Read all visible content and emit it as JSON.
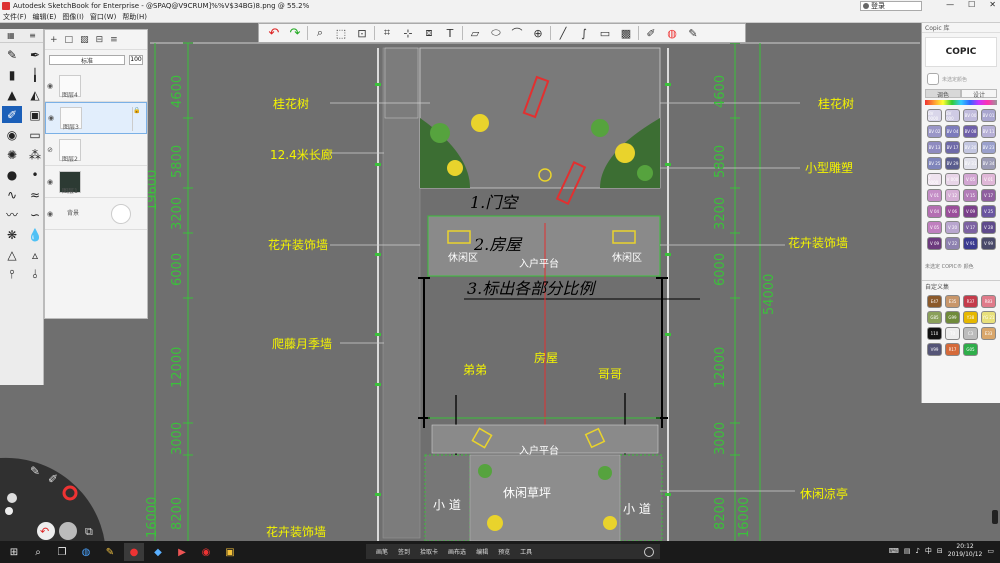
{
  "window": {
    "title": "Autodesk SketchBook for Enterprise - @SPAQ@V9CRUM]%%V$34BG)8.png @ 55.2%",
    "minimize": "—",
    "maximize": "☐",
    "close": "✕",
    "login_label": "登录"
  },
  "menu": [
    "文件(F)",
    "编辑(E)",
    "图像(I)",
    "窗口(W)",
    "帮助(H)"
  ],
  "toolbar": {
    "tools": [
      "undo-icon",
      "redo-icon",
      "zoom-icon",
      "select-icon",
      "lasso-icon",
      "crop-icon",
      "transform-icon",
      "symmetry-icon",
      "text-icon",
      "ruler-icon",
      "ellipse-icon",
      "french-curve-icon",
      "perspective-icon",
      "line-icon",
      "curve-icon",
      "rect-icon",
      "fill-icon",
      "copic-icon",
      "color-wheel-icon",
      "brush-icon"
    ]
  },
  "layers": {
    "blend_mode": "标准",
    "opacity": "100",
    "items": [
      {
        "name": "图层4"
      },
      {
        "name": "图层3"
      },
      {
        "name": "图层2"
      },
      {
        "name": "图层1"
      },
      {
        "name": "背景"
      }
    ]
  },
  "plan": {
    "left_labels": [
      "桂花树",
      "12.4米长廊",
      "花卉装饰墙",
      "爬藤月季墙",
      "花卉装饰墙"
    ],
    "right_labels": [
      "桂花树",
      "小型雕塑",
      "花卉装饰墙",
      "休闲凉亭"
    ],
    "center_labels": {
      "entry_top": "入户平台",
      "rest_left": "休闲区",
      "rest_right": "休闲区",
      "house": "房屋",
      "younger": "弟弟",
      "elder": "哥哥",
      "entry_bottom": "入户平台",
      "lawn": "休闲草坪",
      "path_left": "小 道",
      "path_right": "小 道"
    },
    "left_dims": [
      "4600",
      "5800",
      "3200",
      "6000",
      "12000",
      "3000",
      "8200"
    ],
    "left_outer_dims": [
      "19600",
      "16000"
    ],
    "right_dims": [
      "4600",
      "5800",
      "3200",
      "6000",
      "12000",
      "3000",
      "8200"
    ],
    "right_outer_dims": [
      "54000",
      "16000"
    ],
    "handwriting": [
      "1.门空",
      "2.房屋",
      "3.标出各部分比例"
    ]
  },
  "copic": {
    "title": "Copic 库",
    "logo": "COPIC",
    "no_color": "未选定颜色",
    "tabs": [
      "调色",
      "设计"
    ],
    "library_colors": [
      {
        "code": "BV 0000",
        "color": "#d9d6ea"
      },
      {
        "code": "BV 000",
        "color": "#cfcbe4"
      },
      {
        "code": "BV 00",
        "color": "#c0bbdc"
      },
      {
        "code": "BV 01",
        "color": "#a9a6cf"
      },
      {
        "code": "BV 02",
        "color": "#9a96c8"
      },
      {
        "code": "BV 04",
        "color": "#7d7cbc"
      },
      {
        "code": "BV 08",
        "color": "#6e5fa9"
      },
      {
        "code": "BV 11",
        "color": "#b6b0d6"
      },
      {
        "code": "BV 13",
        "color": "#8f8bc0"
      },
      {
        "code": "BV 17",
        "color": "#6f6aa8"
      },
      {
        "code": "BV 20",
        "color": "#c3c6e0"
      },
      {
        "code": "BV 23",
        "color": "#9aa0cc"
      },
      {
        "code": "BV 25",
        "color": "#7f85bb"
      },
      {
        "code": "BV 29",
        "color": "#5a5d8e"
      },
      {
        "code": "BV 31",
        "color": "#e2e2ec"
      },
      {
        "code": "BV 34",
        "color": "#9c9cb6"
      },
      {
        "code": "V 0000",
        "color": "#efe3ef"
      },
      {
        "code": "V 000",
        "color": "#e8d5e8"
      },
      {
        "code": "V 05",
        "color": "#d2a6d2"
      },
      {
        "code": "V 01",
        "color": "#e0b8d8"
      },
      {
        "code": "V 01",
        "color": "#c58ec7"
      },
      {
        "code": "V 12",
        "color": "#d6b0d6"
      },
      {
        "code": "V 15",
        "color": "#b27cb8"
      },
      {
        "code": "V 17",
        "color": "#8f5f9f"
      },
      {
        "code": "V 04",
        "color": "#b46fb2"
      },
      {
        "code": "V 06",
        "color": "#9a4e9a"
      },
      {
        "code": "V 09",
        "color": "#7a3f8a"
      },
      {
        "code": "V 25",
        "color": "#6a55a0"
      },
      {
        "code": "V 05",
        "color": "#c07fbf"
      },
      {
        "code": "V 20",
        "color": "#b9a6cf"
      },
      {
        "code": "V 17",
        "color": "#7d62a2"
      },
      {
        "code": "V 28",
        "color": "#5f4a8c"
      },
      {
        "code": "V 09",
        "color": "#6d3b7e"
      },
      {
        "code": "V 22",
        "color": "#8e82b0"
      },
      {
        "code": "V 91",
        "color": "#3b3b8f"
      },
      {
        "code": "V 99",
        "color": "#4a4a6a"
      }
    ],
    "library_footer": "未选定 COPIC® 颜色",
    "custom_title": "自定义集",
    "custom_colors": [
      {
        "code": "E47",
        "color": "#8b5a2b"
      },
      {
        "code": "E35",
        "color": "#c8966a"
      },
      {
        "code": "R37",
        "color": "#c43b4a"
      },
      {
        "code": "R83",
        "color": "#e07b8a"
      },
      {
        "code": "G85",
        "color": "#8aa05a"
      },
      {
        "code": "G99",
        "color": "#6f8a3a"
      },
      {
        "code": "Y38",
        "color": "#e6b800"
      },
      {
        "code": "YG 21",
        "color": "#e8e07a"
      },
      {
        "code": "110",
        "color": "#111111"
      },
      {
        "code": "T0",
        "color": "#eeeeee"
      },
      {
        "code": "C3",
        "color": "#bcbcbc"
      },
      {
        "code": "E33",
        "color": "#d9a66a"
      },
      {
        "code": "V99",
        "color": "#555577"
      },
      {
        "code": "R17",
        "color": "#d56a3a"
      },
      {
        "code": "G05",
        "color": "#2fae4a"
      }
    ]
  },
  "bottom_tabs": [
    "画笔",
    "签到",
    "拾取卡",
    "画布选",
    "编辑",
    "预览",
    "工具"
  ],
  "taskbar": {
    "apps": [
      "windows-start-icon",
      "search-icon",
      "task-view-icon",
      "browser-icon",
      "pen-icon",
      "record-icon",
      "paint-icon",
      "presentation-icon",
      "sketchbook-icon",
      "gallery-icon"
    ],
    "language": "中",
    "time": "20:12",
    "date": "2019/10/12"
  },
  "colors": {
    "plan_line": "#ffffff",
    "dim_green": "#3ac23a",
    "label_yellow": "#f4f400",
    "axis_red": "#e23030",
    "canvas": "#6f6f6f",
    "brand_active": "#1b5fb8"
  }
}
